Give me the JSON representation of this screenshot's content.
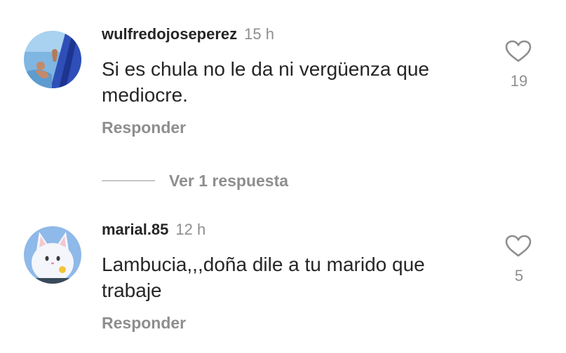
{
  "comments": [
    {
      "username": "wulfredojoseperez",
      "time": "15 h",
      "text": "Si es chula no le da ni vergüenza que mediocre.",
      "reply_label": "Responder",
      "likes": "19",
      "like_icon": "heart-outline-icon"
    },
    {
      "username": "marial.85",
      "time": "12 h",
      "text": "Lambucia,,,doña dile a tu marido que trabaje",
      "reply_label": "Responder",
      "likes": "5",
      "like_icon": "heart-outline-icon"
    }
  ],
  "view_replies": {
    "label": "Ver 1 respuesta"
  },
  "colors": {
    "primary_text": "#262626",
    "secondary_text": "#8e8e8e",
    "divider": "#c7c7c7"
  }
}
